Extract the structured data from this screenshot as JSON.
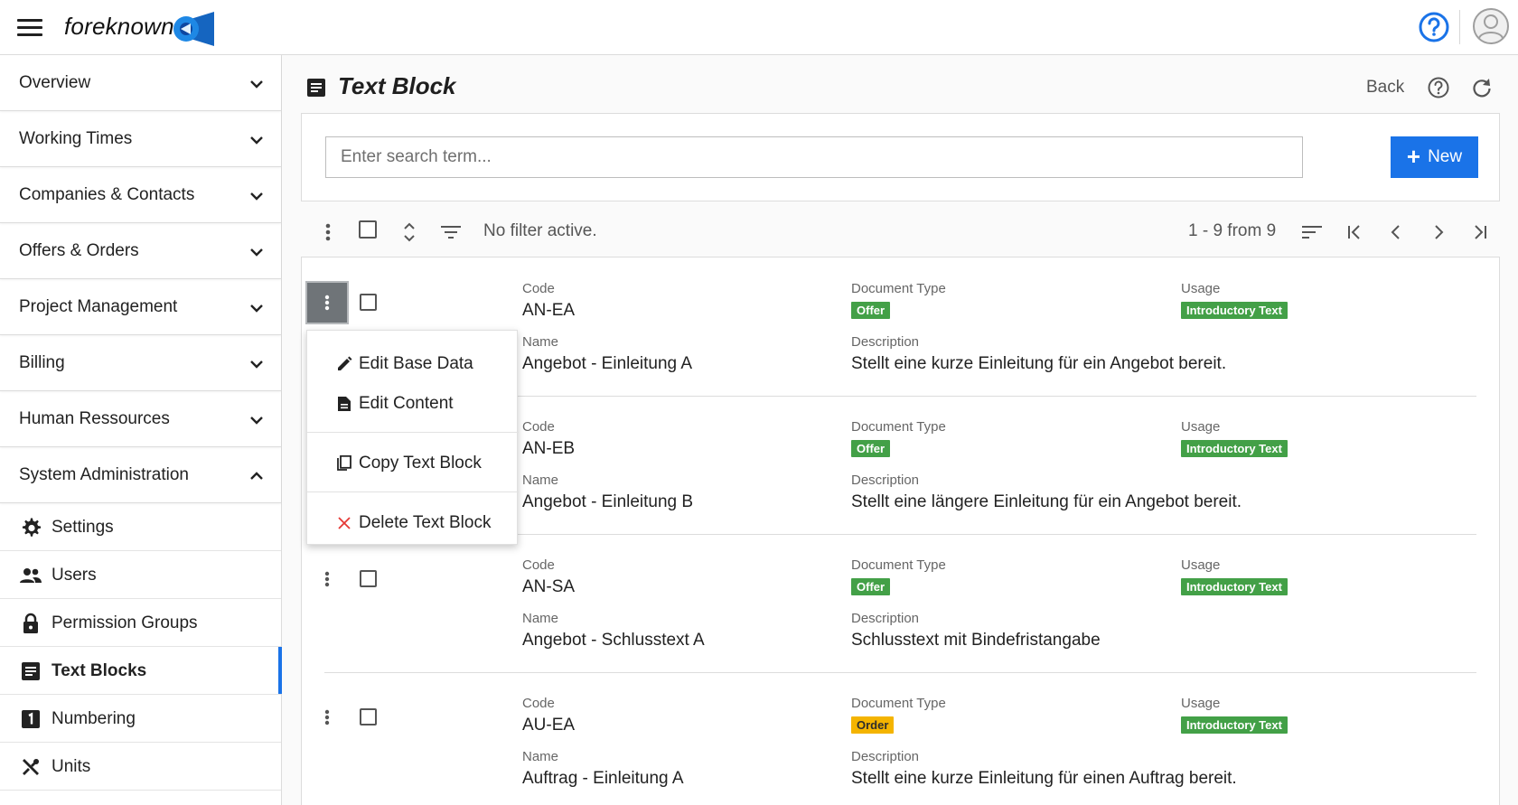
{
  "app": {
    "logo_text": "foreknown"
  },
  "sidebar": {
    "sections": [
      {
        "label": "Overview",
        "expanded": false
      },
      {
        "label": "Working Times",
        "expanded": false
      },
      {
        "label": "Companies & Contacts",
        "expanded": false
      },
      {
        "label": "Offers & Orders",
        "expanded": false
      },
      {
        "label": "Project Management",
        "expanded": false
      },
      {
        "label": "Billing",
        "expanded": false
      },
      {
        "label": "Human Ressources",
        "expanded": false
      },
      {
        "label": "System Administration",
        "expanded": true
      }
    ],
    "sub_items": [
      {
        "label": "Settings",
        "icon": "gear-icon"
      },
      {
        "label": "Users",
        "icon": "users-icon"
      },
      {
        "label": "Permission Groups",
        "icon": "lock-icon"
      },
      {
        "label": "Text Blocks",
        "icon": "text-block-icon",
        "active": true
      },
      {
        "label": "Numbering",
        "icon": "numbering-icon"
      },
      {
        "label": "Units",
        "icon": "tools-icon"
      }
    ]
  },
  "page": {
    "title": "Text Block",
    "back_label": "Back"
  },
  "search": {
    "placeholder": "Enter search term...",
    "value": ""
  },
  "new_button": {
    "label": "New"
  },
  "toolbar": {
    "filter_status": "No filter active.",
    "pagination": "1 - 9 from 9"
  },
  "field_labels": {
    "code": "Code",
    "document_type": "Document Type",
    "usage": "Usage",
    "name": "Name",
    "description": "Description"
  },
  "rows": [
    {
      "code": "AN-EA",
      "document_type": "Offer",
      "usage": "Introductory Text",
      "name": "Angebot - Einleitung A",
      "description": "Stellt eine kurze Einleitung für ein Angebot bereit."
    },
    {
      "code": "AN-EB",
      "document_type": "Offer",
      "usage": "Introductory Text",
      "name": "Angebot - Einleitung B",
      "description": "Stellt eine längere Einleitung für ein Angebot bereit."
    },
    {
      "code": "AN-SA",
      "document_type": "Offer",
      "usage": "Introductory Text",
      "name": "Angebot - Schlusstext A",
      "description": "Schlusstext mit Bindefristangabe"
    },
    {
      "code": "AU-EA",
      "document_type": "Order",
      "usage": "Introductory Text",
      "name": "Auftrag - Einleitung A",
      "description": "Stellt eine kurze Einleitung für einen Auftrag bereit."
    }
  ],
  "context_menu": {
    "items": [
      {
        "label": "Edit Base Data",
        "icon": "pencil-icon"
      },
      {
        "label": "Edit Content",
        "icon": "document-icon"
      },
      {
        "label": "Copy Text Block",
        "icon": "copy-icon"
      },
      {
        "label": "Delete Text Block",
        "icon": "delete-x-icon"
      }
    ]
  },
  "colors": {
    "accent": "#1a73e8",
    "badge_offer": "#43a047",
    "badge_order": "#f4b400",
    "badge_usage": "#43a047"
  }
}
